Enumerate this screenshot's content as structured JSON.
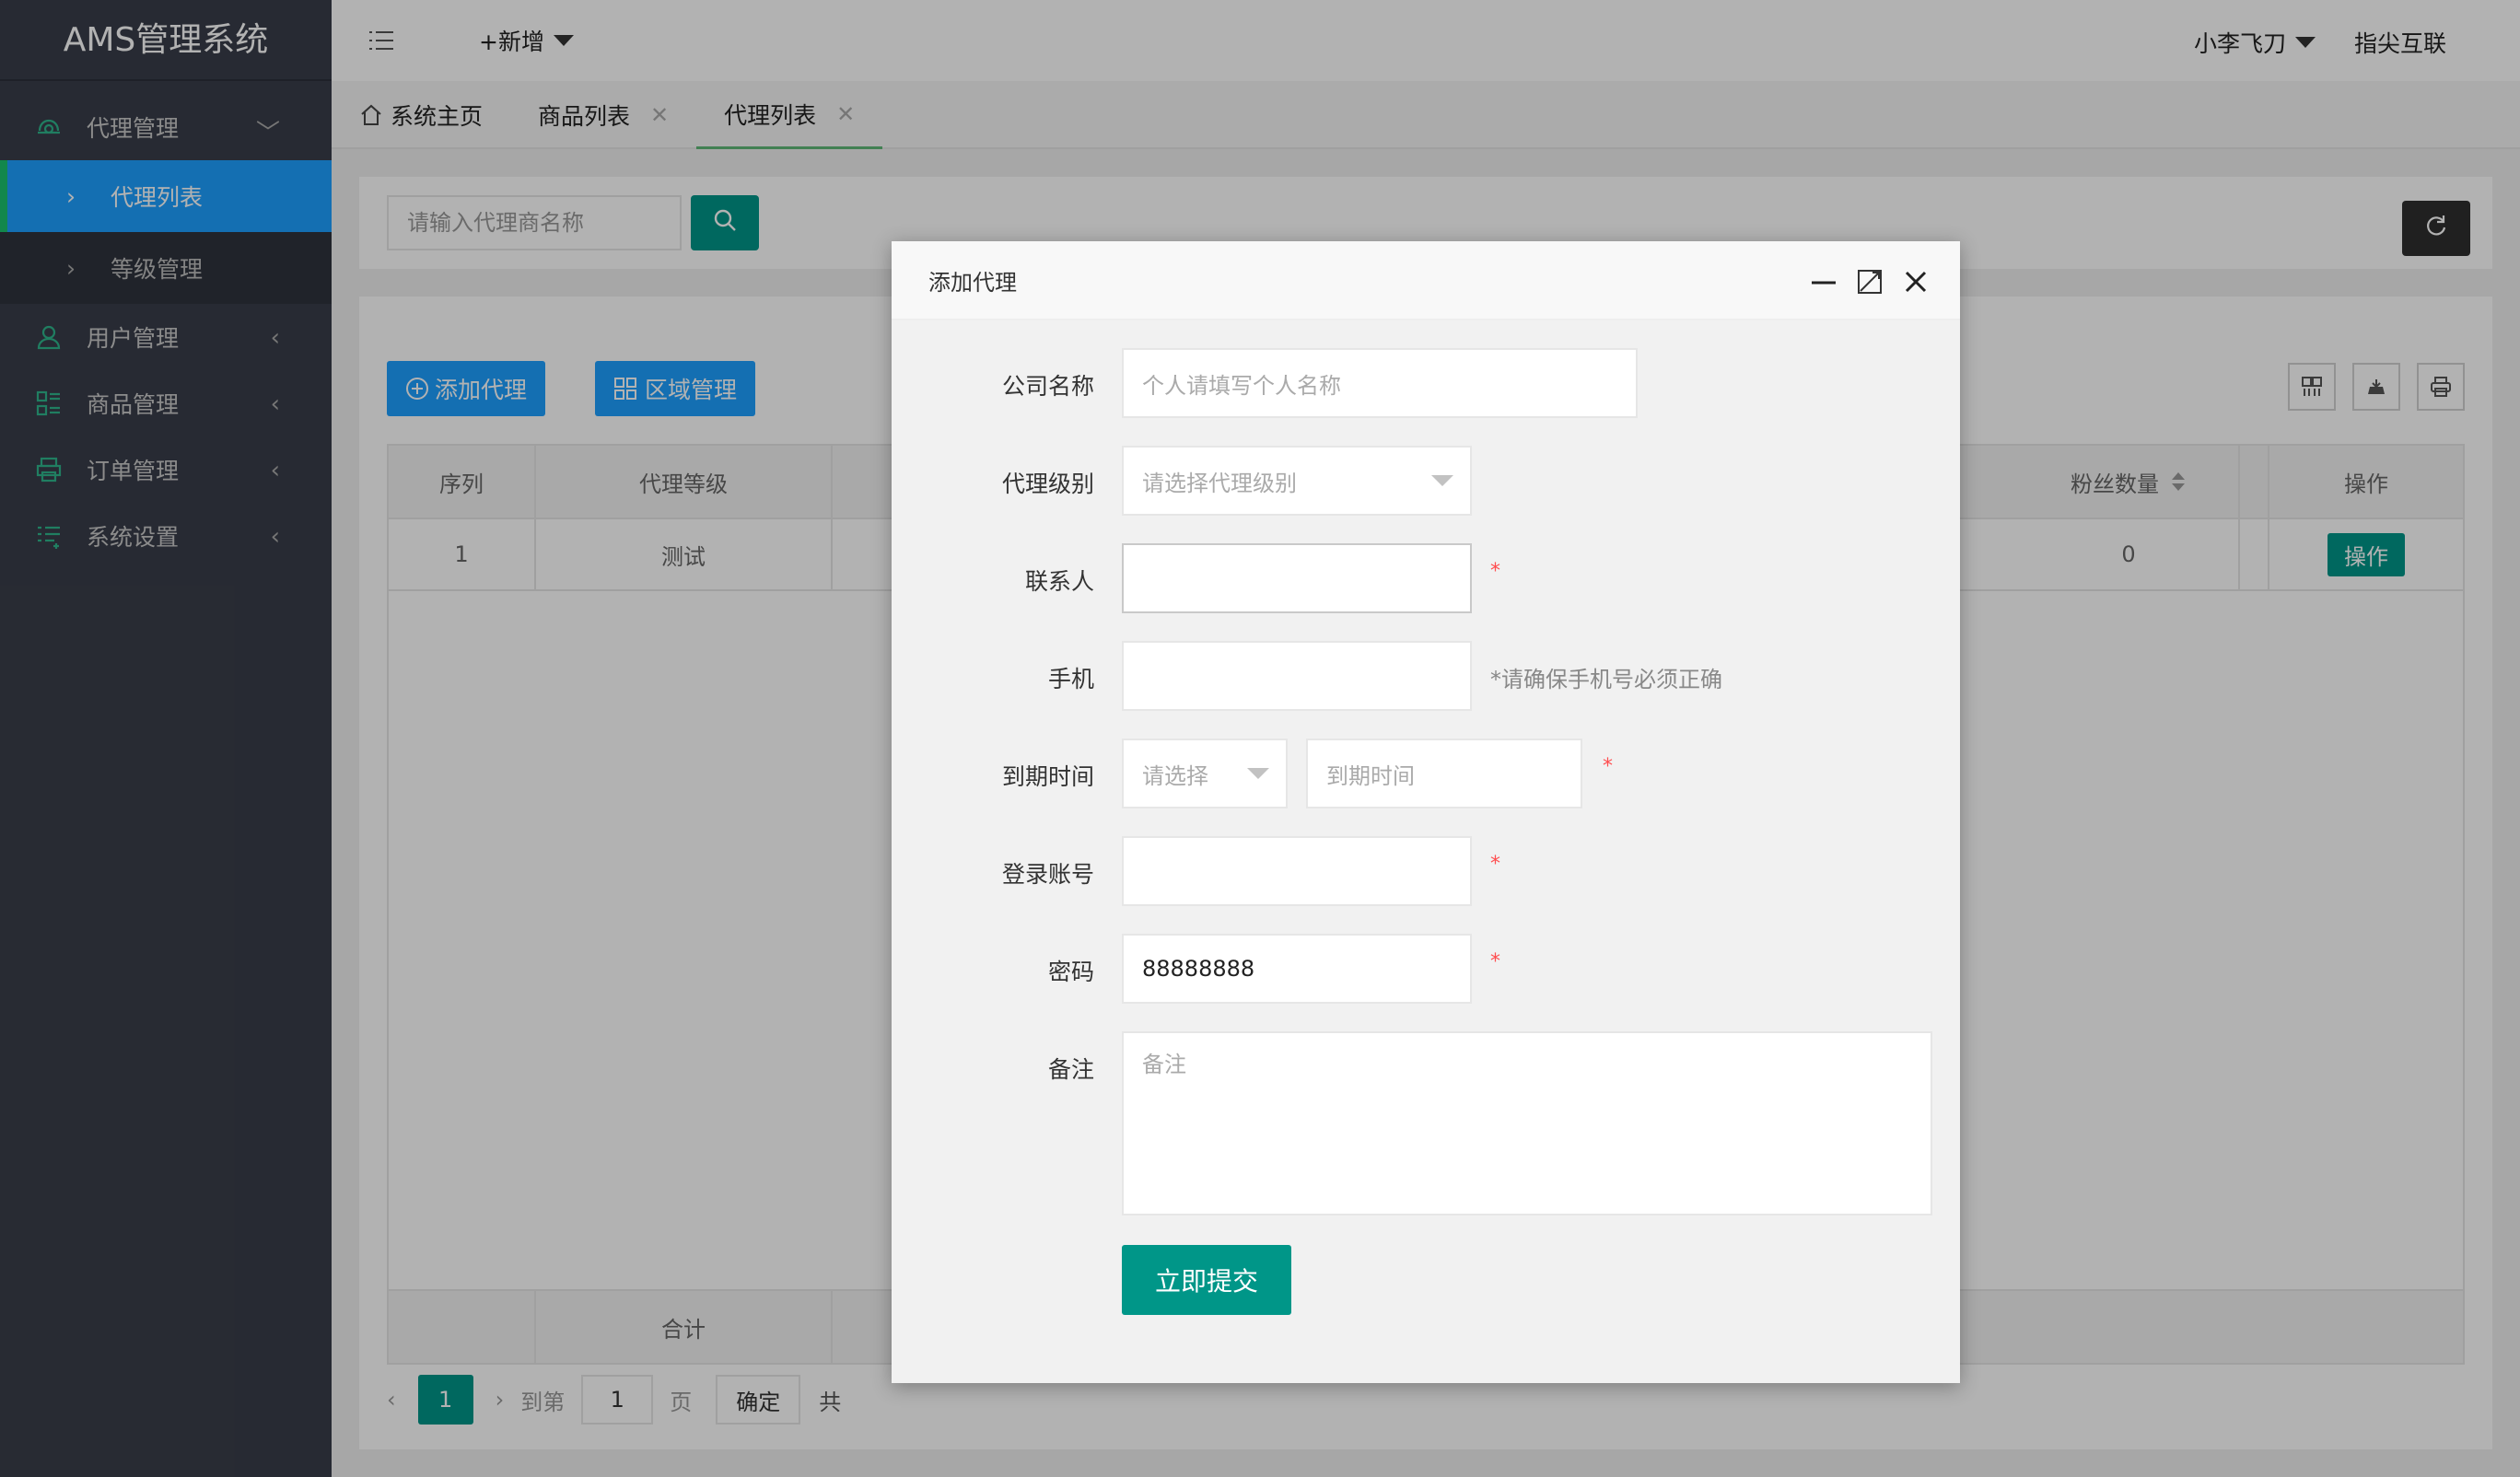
{
  "app": {
    "title": "AMS管理系统"
  },
  "sidebar": {
    "groups": [
      {
        "label": "代理管理",
        "icon": "agent-icon",
        "arrow": "﹀"
      },
      {
        "label": "用户管理",
        "icon": "user-icon",
        "arrow": "‹"
      },
      {
        "label": "商品管理",
        "icon": "goods-icon",
        "arrow": "‹"
      },
      {
        "label": "订单管理",
        "icon": "order-icon",
        "arrow": "‹"
      },
      {
        "label": "系统设置",
        "icon": "settings-icon",
        "arrow": "‹"
      }
    ],
    "subitems": [
      {
        "label": "代理列表",
        "active": true
      },
      {
        "label": "等级管理",
        "active": false
      }
    ]
  },
  "header": {
    "new_label": "+新增",
    "user_name": "小李飞刀",
    "brand_link": "指尖互联"
  },
  "tabs": [
    {
      "label": "系统主页",
      "closable": false
    },
    {
      "label": "商品列表",
      "closable": true
    },
    {
      "label": "代理列表",
      "closable": true,
      "active": true
    }
  ],
  "search": {
    "placeholder": "请输入代理商名称"
  },
  "toolbar": {
    "add_label": "添加代理",
    "region_label": "区域管理"
  },
  "table": {
    "headers": {
      "seq": "序列",
      "level": "代理等级",
      "fans": "粉丝数量",
      "op": "操作"
    },
    "row": {
      "seq": "1",
      "level": "测试",
      "fans": "0",
      "op": "操作"
    },
    "footer_label": "合计"
  },
  "pager": {
    "current": "1",
    "goto_label": "到第",
    "page_input": "1",
    "page_unit": "页",
    "confirm": "确定",
    "total_prefix": "共"
  },
  "modal": {
    "title": "添加代理",
    "fields": {
      "company": {
        "label": "公司名称",
        "placeholder": "个人请填写个人名称"
      },
      "level": {
        "label": "代理级别",
        "placeholder": "请选择代理级别"
      },
      "contact": {
        "label": "联系人",
        "required": "*"
      },
      "phone": {
        "label": "手机",
        "hint": "*请确保手机号必须正确"
      },
      "expire": {
        "label": "到期时间",
        "select_placeholder": "请选择",
        "date_placeholder": "到期时间",
        "required": "*"
      },
      "account": {
        "label": "登录账号",
        "required": "*"
      },
      "password": {
        "label": "密码",
        "value": "88888888",
        "required": "*"
      },
      "remark": {
        "label": "备注",
        "placeholder": "备注"
      }
    },
    "submit_label": "立即提交"
  },
  "colors": {
    "sidebar": "#393d49",
    "active_nav": "#1e9fff",
    "primary": "#009688",
    "required": "#ff4d4f"
  }
}
